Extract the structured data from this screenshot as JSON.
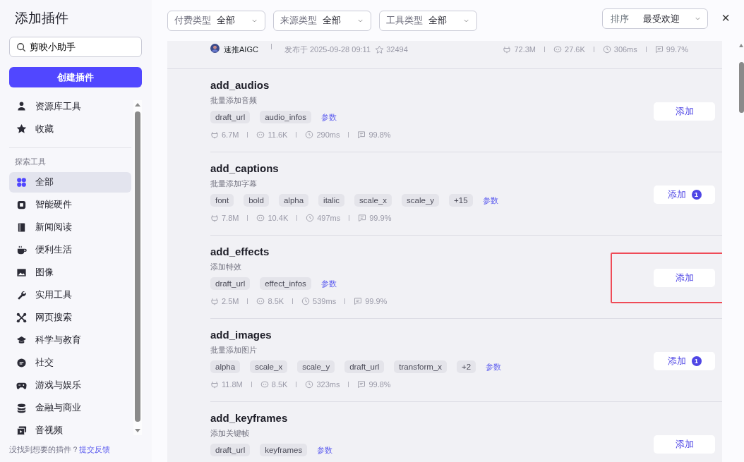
{
  "sidebar": {
    "title": "添加插件",
    "search": {
      "value": "剪映小助手"
    },
    "create_button": "创建插件",
    "top_items": [
      {
        "label": "资源库工具",
        "selected": false
      },
      {
        "label": "收藏",
        "selected": false
      }
    ],
    "section_label": "探索工具",
    "items": [
      {
        "label": "全部",
        "selected": true
      },
      {
        "label": "智能硬件",
        "selected": false
      },
      {
        "label": "新闻阅读",
        "selected": false
      },
      {
        "label": "便利生活",
        "selected": false
      },
      {
        "label": "图像",
        "selected": false
      },
      {
        "label": "实用工具",
        "selected": false
      },
      {
        "label": "网页搜索",
        "selected": false
      },
      {
        "label": "科学与教育",
        "selected": false
      },
      {
        "label": "社交",
        "selected": false
      },
      {
        "label": "游戏与娱乐",
        "selected": false
      },
      {
        "label": "金融与商业",
        "selected": false
      },
      {
        "label": "音视频",
        "selected": false
      }
    ],
    "footer": {
      "text": "没找到想要的插件？",
      "link": "提交反馈"
    }
  },
  "filters": [
    {
      "label": "付费类型",
      "value": "全部"
    },
    {
      "label": "来源类型",
      "value": "全部"
    },
    {
      "label": "工具类型",
      "value": "全部"
    }
  ],
  "sort": {
    "label": "排序",
    "value": "最受欢迎"
  },
  "close": "×",
  "header_row": {
    "author": "速推AIGC",
    "published": "发布于 2025-09-28 09:11",
    "stars": "32494",
    "stats": [
      "72.3M",
      "27.6K",
      "306ms",
      "99.7%"
    ]
  },
  "plugins": [
    {
      "name": "add_audios",
      "desc": "批量添加音频",
      "tags": [
        "draft_url",
        "audio_infos"
      ],
      "params": "参数",
      "stats": [
        "6.7M",
        "11.6K",
        "290ms",
        "99.8%"
      ],
      "button": "添加",
      "highlighted": false
    },
    {
      "name": "add_captions",
      "desc": "批量添加字幕",
      "tags": [
        "font",
        "bold",
        "alpha",
        "italic",
        "scale_x",
        "scale_y",
        "+15"
      ],
      "params": "参数",
      "stats": [
        "7.8M",
        "10.4K",
        "497ms",
        "99.9%"
      ],
      "button": "添加",
      "badge": "1",
      "highlighted": false
    },
    {
      "name": "add_effects",
      "desc": "添加特效",
      "tags": [
        "draft_url",
        "effect_infos"
      ],
      "params": "参数",
      "stats": [
        "2.5M",
        "8.5K",
        "539ms",
        "99.9%"
      ],
      "button": "添加",
      "highlighted": true
    },
    {
      "name": "add_images",
      "desc": "批量添加图片",
      "tags": [
        "alpha",
        "scale_x",
        "scale_y",
        "draft_url",
        "transform_x",
        "+2"
      ],
      "params": "参数",
      "stats": [
        "11.8M",
        "8.5K",
        "323ms",
        "99.8%"
      ],
      "button": "添加",
      "badge": "1",
      "highlighted": false
    },
    {
      "name": "add_keyframes",
      "desc": "添加关键帧",
      "tags": [
        "draft_url",
        "keyframes"
      ],
      "params": "参数",
      "button": "添加",
      "highlighted": false
    }
  ]
}
